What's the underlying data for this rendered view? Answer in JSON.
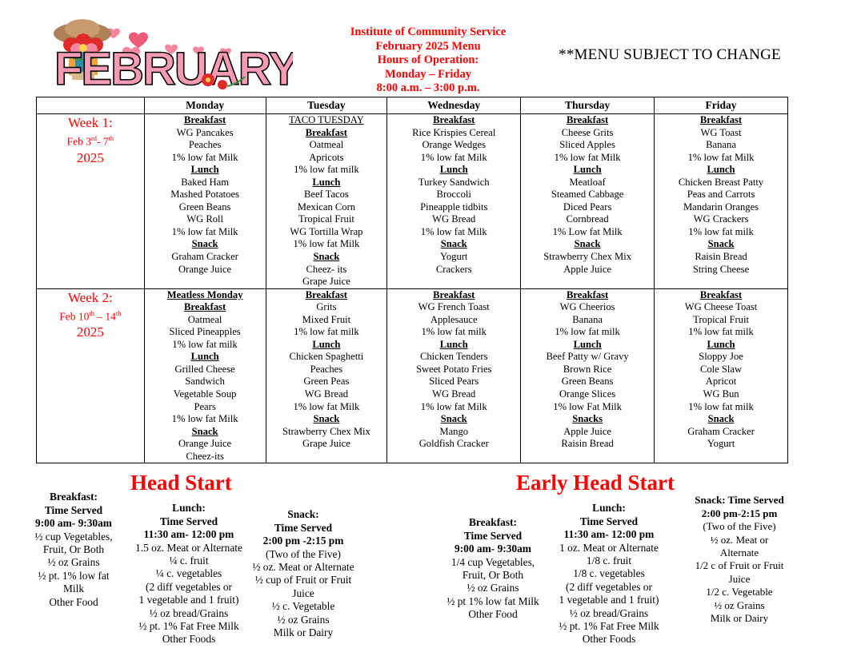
{
  "header": {
    "clipart_label": "FEBRUARY",
    "center_lines": [
      "Institute of Community Service",
      "February 2025 Menu",
      "Hours of Operation:",
      "Monday – Friday",
      "8:00 a.m. – 3:00 p.m."
    ],
    "notice": "**MENU SUBJECT TO CHANGE",
    "accent_color": "#ff0000"
  },
  "table": {
    "columns": [
      "",
      "Monday",
      "Tuesday",
      "Wednesday",
      "Thursday",
      "Friday"
    ],
    "weeks": [
      {
        "title": "Week 1:",
        "dates_prefix": "Feb 3",
        "dates_sup1": "rd",
        "dates_mid": "- 7",
        "dates_sup2": "th",
        "year": "2025",
        "days": {
          "monday": {
            "special": "",
            "lines": [
              {
                "text": "Breakfast",
                "style": "hd"
              },
              {
                "text": "WG Pancakes",
                "style": ""
              },
              {
                "text": "Peaches",
                "style": ""
              },
              {
                "text": "1% low fat Milk",
                "style": ""
              },
              {
                "text": "Lunch",
                "style": "hd"
              },
              {
                "text": "Baked Ham",
                "style": ""
              },
              {
                "text": "Mashed Potatoes",
                "style": ""
              },
              {
                "text": "Green Beans",
                "style": ""
              },
              {
                "text": "WG Roll",
                "style": ""
              },
              {
                "text": "1% low fat Milk",
                "style": ""
              },
              {
                "text": "Snack",
                "style": "hd"
              },
              {
                "text": "Graham Cracker",
                "style": ""
              },
              {
                "text": "Orange Juice",
                "style": ""
              }
            ]
          },
          "tuesday": {
            "lines": [
              {
                "text": "TACO TUESDAY",
                "style": "special"
              },
              {
                "text": "Breakfast",
                "style": "hd"
              },
              {
                "text": "Oatmeal",
                "style": ""
              },
              {
                "text": "Apricots",
                "style": ""
              },
              {
                "text": "1% low fat milk",
                "style": ""
              },
              {
                "text": "Lunch",
                "style": "hd"
              },
              {
                "text": "Beef Tacos",
                "style": ""
              },
              {
                "text": "Mexican Corn",
                "style": ""
              },
              {
                "text": "Tropical Fruit",
                "style": ""
              },
              {
                "text": "WG Tortilla Wrap",
                "style": ""
              },
              {
                "text": "1% low fat Milk",
                "style": ""
              },
              {
                "text": "Snack",
                "style": "hd"
              },
              {
                "text": "Cheez- its",
                "style": ""
              },
              {
                "text": "Grape Juice",
                "style": ""
              }
            ]
          },
          "wednesday": {
            "lines": [
              {
                "text": "Breakfast",
                "style": "hd"
              },
              {
                "text": "Rice Krispies Cereal",
                "style": ""
              },
              {
                "text": "Orange Wedges",
                "style": ""
              },
              {
                "text": "1% low fat Milk",
                "style": ""
              },
              {
                "text": "Lunch",
                "style": "hd"
              },
              {
                "text": "Turkey Sandwich",
                "style": ""
              },
              {
                "text": "Broccoli",
                "style": ""
              },
              {
                "text": "Pineapple tidbits",
                "style": ""
              },
              {
                "text": "WG Bread",
                "style": ""
              },
              {
                "text": "1% low fat Milk",
                "style": ""
              },
              {
                "text": "Snack",
                "style": "hd"
              },
              {
                "text": "Yogurt",
                "style": ""
              },
              {
                "text": "Crackers",
                "style": ""
              }
            ]
          },
          "thursday": {
            "lines": [
              {
                "text": "Breakfast",
                "style": "hd"
              },
              {
                "text": "Cheese Grits",
                "style": ""
              },
              {
                "text": "Sliced Apples",
                "style": ""
              },
              {
                "text": "1% low fat Milk",
                "style": ""
              },
              {
                "text": "Lunch",
                "style": "hd"
              },
              {
                "text": "Meatloaf",
                "style": ""
              },
              {
                "text": "Steamed Cabbage",
                "style": ""
              },
              {
                "text": "Diced Pears",
                "style": ""
              },
              {
                "text": "Cornbread",
                "style": ""
              },
              {
                "text": "1% Low fat Milk",
                "style": ""
              },
              {
                "text": "Snack",
                "style": "hd"
              },
              {
                "text": "Strawberry Chex Mix",
                "style": ""
              },
              {
                "text": "Apple Juice",
                "style": ""
              }
            ]
          },
          "friday": {
            "lines": [
              {
                "text": "Breakfast",
                "style": "hd"
              },
              {
                "text": "WG Toast",
                "style": ""
              },
              {
                "text": "Banana",
                "style": ""
              },
              {
                "text": "1% low fat Milk",
                "style": ""
              },
              {
                "text": "Lunch",
                "style": "hd"
              },
              {
                "text": "Chicken Breast Patty",
                "style": ""
              },
              {
                "text": "Peas and Carrots",
                "style": ""
              },
              {
                "text": "Mandarin Oranges",
                "style": ""
              },
              {
                "text": "WG Crackers",
                "style": ""
              },
              {
                "text": "1% low fat milk",
                "style": ""
              },
              {
                "text": "Snack",
                "style": "hd"
              },
              {
                "text": "Raisin Bread",
                "style": ""
              },
              {
                "text": "String Cheese",
                "style": ""
              }
            ]
          }
        }
      },
      {
        "title": "Week 2:",
        "dates_prefix": "Feb 10",
        "dates_sup1": "th",
        "dates_mid": " – 14",
        "dates_sup2": "th",
        "year": "2025",
        "days": {
          "monday": {
            "lines": [
              {
                "text": "Meatless Monday",
                "style": "hd"
              },
              {
                "text": "Breakfast",
                "style": "hd"
              },
              {
                "text": "Oatmeal",
                "style": ""
              },
              {
                "text": "Sliced Pineapples",
                "style": ""
              },
              {
                "text": "1% low fat milk",
                "style": ""
              },
              {
                "text": "Lunch",
                "style": "hd"
              },
              {
                "text": "Grilled Cheese",
                "style": ""
              },
              {
                "text": "Sandwich",
                "style": ""
              },
              {
                "text": "Vegetable Soup",
                "style": ""
              },
              {
                "text": "Pears",
                "style": ""
              },
              {
                "text": "1% low fat Milk",
                "style": ""
              },
              {
                "text": "Snack",
                "style": "hd"
              },
              {
                "text": "Orange Juice",
                "style": ""
              },
              {
                "text": "Cheez-its",
                "style": ""
              }
            ]
          },
          "tuesday": {
            "lines": [
              {
                "text": "Breakfast",
                "style": "hd"
              },
              {
                "text": "Grits",
                "style": ""
              },
              {
                "text": "Mixed Fruit",
                "style": ""
              },
              {
                "text": "1% low fat milk",
                "style": ""
              },
              {
                "text": "Lunch",
                "style": "hd"
              },
              {
                "text": "Chicken Spaghetti",
                "style": ""
              },
              {
                "text": "Peaches",
                "style": ""
              },
              {
                "text": "Green Peas",
                "style": ""
              },
              {
                "text": "WG Bread",
                "style": ""
              },
              {
                "text": "1% low fat Milk",
                "style": ""
              },
              {
                "text": "Snack",
                "style": "hd"
              },
              {
                "text": "Strawberry Chex Mix",
                "style": ""
              },
              {
                "text": "Grape Juice",
                "style": ""
              }
            ]
          },
          "wednesday": {
            "lines": [
              {
                "text": "Breakfast",
                "style": "hd"
              },
              {
                "text": "WG French Toast",
                "style": ""
              },
              {
                "text": "Applesauce",
                "style": ""
              },
              {
                "text": "1% low fat milk",
                "style": ""
              },
              {
                "text": "Lunch",
                "style": "hd"
              },
              {
                "text": "Chicken Tenders",
                "style": ""
              },
              {
                "text": "Sweet Potato Fries",
                "style": ""
              },
              {
                "text": "Sliced Pears",
                "style": ""
              },
              {
                "text": "WG Bread",
                "style": ""
              },
              {
                "text": "1% low fat Milk",
                "style": ""
              },
              {
                "text": "Snack",
                "style": "hd"
              },
              {
                "text": "Mango",
                "style": ""
              },
              {
                "text": "Goldfish Cracker",
                "style": ""
              }
            ]
          },
          "thursday": {
            "lines": [
              {
                "text": "Breakfast",
                "style": "hd"
              },
              {
                "text": "WG Cheerios",
                "style": ""
              },
              {
                "text": "Banana",
                "style": ""
              },
              {
                "text": "1% low fat milk",
                "style": ""
              },
              {
                "text": "Lunch",
                "style": "hd"
              },
              {
                "text": "Beef Patty w/ Gravy",
                "style": ""
              },
              {
                "text": "Brown Rice",
                "style": ""
              },
              {
                "text": "Green Beans",
                "style": ""
              },
              {
                "text": "Orange Slices",
                "style": ""
              },
              {
                "text": "1% low Fat Milk",
                "style": ""
              },
              {
                "text": "Snacks",
                "style": "hd"
              },
              {
                "text": "Apple Juice",
                "style": ""
              },
              {
                "text": "Raisin Bread",
                "style": ""
              }
            ]
          },
          "friday": {
            "lines": [
              {
                "text": "Breakfast",
                "style": "hd"
              },
              {
                "text": "WG Cheese Toast",
                "style": ""
              },
              {
                "text": "Tropical Fruit",
                "style": ""
              },
              {
                "text": "1% low fat milk",
                "style": ""
              },
              {
                "text": "Lunch",
                "style": "hd"
              },
              {
                "text": "Sloppy Joe",
                "style": ""
              },
              {
                "text": "Cole Slaw",
                "style": ""
              },
              {
                "text": "Apricot",
                "style": ""
              },
              {
                "text": "WG Bun",
                "style": ""
              },
              {
                "text": "1% low fat milk",
                "style": ""
              },
              {
                "text": "Snack",
                "style": "hd"
              },
              {
                "text": "Graham Cracker",
                "style": ""
              },
              {
                "text": "Yogurt",
                "style": ""
              }
            ]
          }
        }
      }
    ]
  },
  "programs": {
    "head_start": {
      "title": "Head Start",
      "breakfast": {
        "label": "Breakfast:",
        "time_label": "Time Served",
        "time": "9:00 am- 9:30am",
        "items": [
          "½ cup Vegetables,",
          "Fruit, Or Both",
          "½ oz Grains",
          "½ pt. 1% low fat",
          "Milk",
          "Other Food"
        ]
      },
      "lunch": {
        "label": "Lunch:",
        "time_label": "Time Served",
        "time": "11:30 am- 12:00 pm",
        "items": [
          "1.5 oz. Meat or Alternate",
          "¼ c. fruit",
          "¼ c. vegetables",
          "(2 diff vegetables or",
          "1 vegetable and 1 fruit)",
          "½ oz bread/Grains",
          "½ pt. 1% Fat Free Milk",
          "Other Foods"
        ]
      },
      "snack": {
        "label": "Snack:",
        "time_label": "Time Served",
        "time": "2:00 pm -2:15 pm",
        "items": [
          "(Two of the Five)",
          "½ oz. Meat or Alternate",
          "½ cup of Fruit or Fruit",
          "Juice",
          "½ c. Vegetable",
          "½ oz Grains",
          "Milk or Dairy"
        ]
      }
    },
    "early_head_start": {
      "title": "Early Head Start",
      "breakfast": {
        "label": "Breakfast:",
        "time_label": "Time Served",
        "time": "9:00 am- 9:30am",
        "items": [
          "1/4 cup Vegetables,",
          "Fruit, Or Both",
          "½ oz Grains",
          "½ pt 1% low fat Milk",
          "Other Food"
        ]
      },
      "lunch": {
        "label": "Lunch:",
        "time_label": "Time Served",
        "time": "11:30 am- 12:00 pm",
        "items": [
          "1 oz. Meat or Alternate",
          "1/8 c. fruit",
          "1/8 c. vegetables",
          "(2 diff vegetables or",
          "1 vegetable and 1 fruit)",
          "½ oz bread/Grains",
          "½ pt. 1% Fat Free Milk",
          "Other Foods"
        ]
      },
      "snack": {
        "label": "Snack: Time Served",
        "time": "2:00 pm-2:15 pm",
        "items": [
          "(Two of the Five)",
          "½ oz. Meat or",
          "Alternate",
          "1/2 c of Fruit or Fruit",
          "Juice",
          "1/2 c. Vegetable",
          "½ oz Grains",
          "Milk or Dairy"
        ]
      }
    }
  }
}
